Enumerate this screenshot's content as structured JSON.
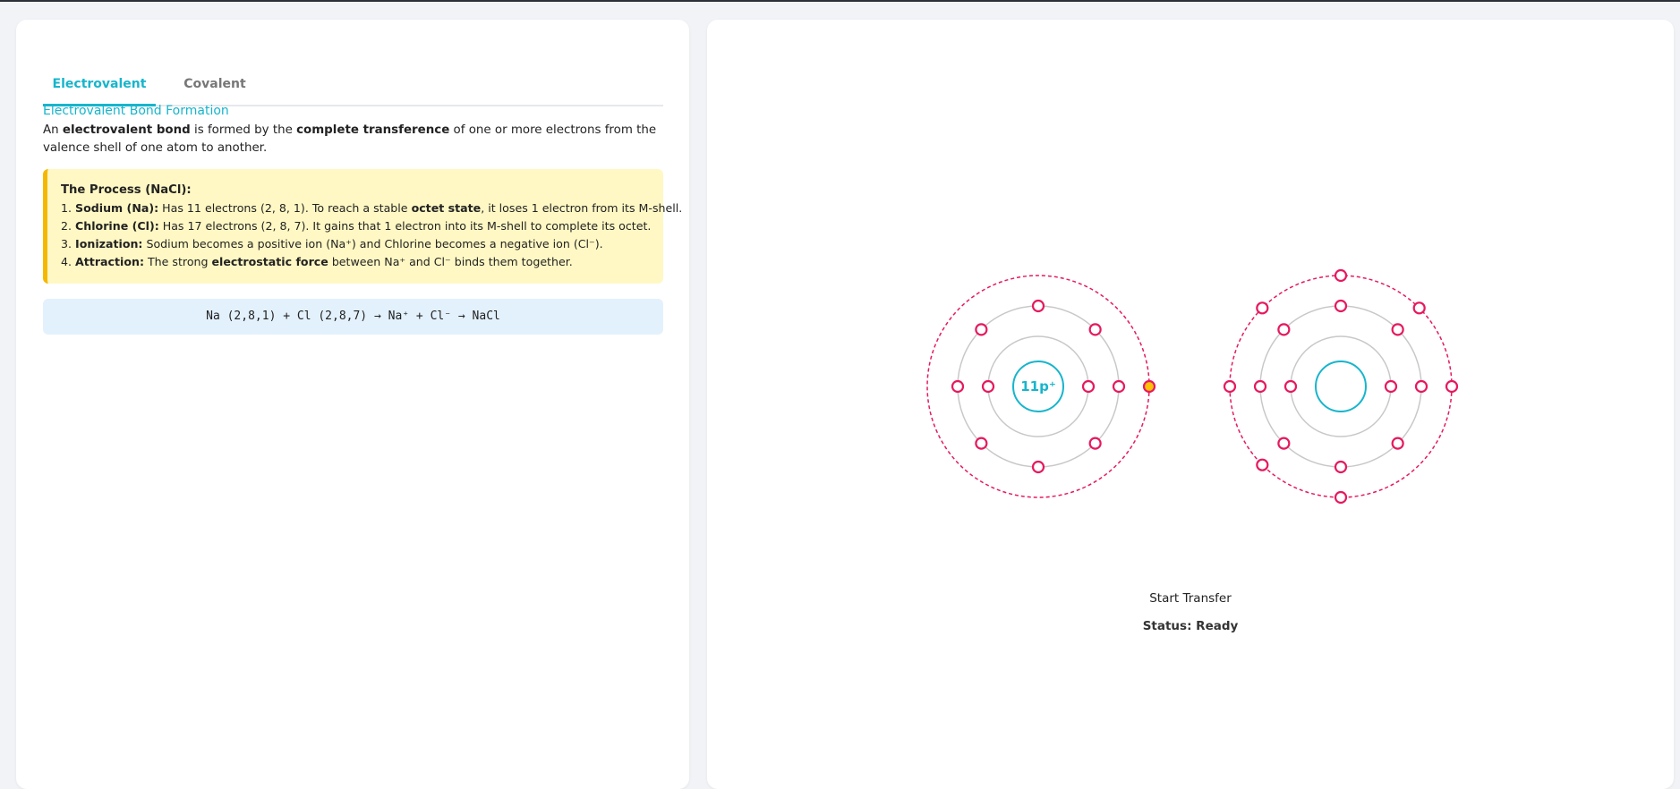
{
  "tabs": [
    {
      "label": "Electrovalent",
      "active": true
    },
    {
      "label": "Covalent",
      "active": false
    }
  ],
  "section_title": "Electrovalent Bond Formation",
  "intro": {
    "p1": "An ",
    "b1": "electrovalent bond",
    "p2": " is formed by the ",
    "b2": "complete transference",
    "p3": " of one or more electrons from the valence shell of one atom to another."
  },
  "process": {
    "title": "The Process (NaCl):",
    "steps": [
      {
        "num": "1. ",
        "term": "Sodium (Na):",
        "text_a": " Has 11 electrons (2, 8, 1). To reach a stable ",
        "bold": "octet state",
        "text_b": ", it loses 1 electron from its M-shell."
      },
      {
        "num": "2. ",
        "term": "Chlorine (Cl):",
        "text_a": " Has 17 electrons (2, 8, 7). It gains that 1 electron into its M-shell to complete its octet.",
        "bold": "",
        "text_b": ""
      },
      {
        "num": "3. ",
        "term": "Ionization:",
        "text_a": " Sodium becomes a positive ion (Na⁺) and Chlorine becomes a negative ion (Cl⁻).",
        "bold": "",
        "text_b": ""
      },
      {
        "num": "4. ",
        "term": "Attraction:",
        "text_a": " The strong ",
        "bold": "electrostatic force",
        "text_b": " between Na⁺ and Cl⁻ binds them together."
      }
    ]
  },
  "equation": "Na (2,8,1) + Cl (2,8,7) → Na⁺ + Cl⁻ → NaCl",
  "atoms": {
    "sodium": {
      "nucleus_label": "11p⁺",
      "shells": [
        2,
        8,
        1
      ]
    },
    "chlorine": {
      "nucleus_label": "",
      "shells": [
        2,
        8,
        7
      ]
    }
  },
  "controls": {
    "start_label": "Start Transfer",
    "status": "Status: Ready"
  },
  "colors": {
    "accent": "#17b5cc",
    "electron": "#e6195f",
    "moving_electron_fill": "#ffc107",
    "process_bg": "#fff8c4",
    "process_border": "#f5b800",
    "equation_bg": "#e3f1fd",
    "shell": "#c8c8c8"
  }
}
